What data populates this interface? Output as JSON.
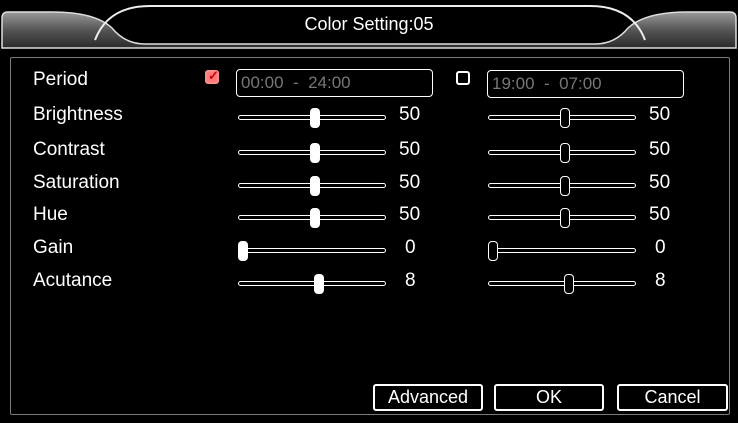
{
  "dialog": {
    "title": "Color Setting:05"
  },
  "period": {
    "label": "Period",
    "range1": {
      "checked": true,
      "value": "00:00  -  24:00"
    },
    "range2": {
      "checked": false,
      "value": "19:00  -  07:00"
    }
  },
  "rows": [
    {
      "id": "brightness",
      "label": "Brightness",
      "p1": 50,
      "p2": 50,
      "f1": 0.52,
      "f2": 0.52
    },
    {
      "id": "contrast",
      "label": "Contrast",
      "p1": 50,
      "p2": 50,
      "f1": 0.52,
      "f2": 0.52
    },
    {
      "id": "saturation",
      "label": "Saturation",
      "p1": 50,
      "p2": 50,
      "f1": 0.52,
      "f2": 0.52
    },
    {
      "id": "hue",
      "label": "Hue",
      "p1": 50,
      "p2": 50,
      "f1": 0.52,
      "f2": 0.52
    },
    {
      "id": "gain",
      "label": "Gain",
      "p1": 0,
      "p2": 0,
      "f1": 0.0,
      "f2": 0.0
    },
    {
      "id": "acutance",
      "label": "Acutance",
      "p1": 8,
      "p2": 8,
      "f1": 0.55,
      "f2": 0.55
    }
  ],
  "buttons": {
    "advanced": "Advanced",
    "ok": "OK",
    "cancel": "Cancel"
  }
}
